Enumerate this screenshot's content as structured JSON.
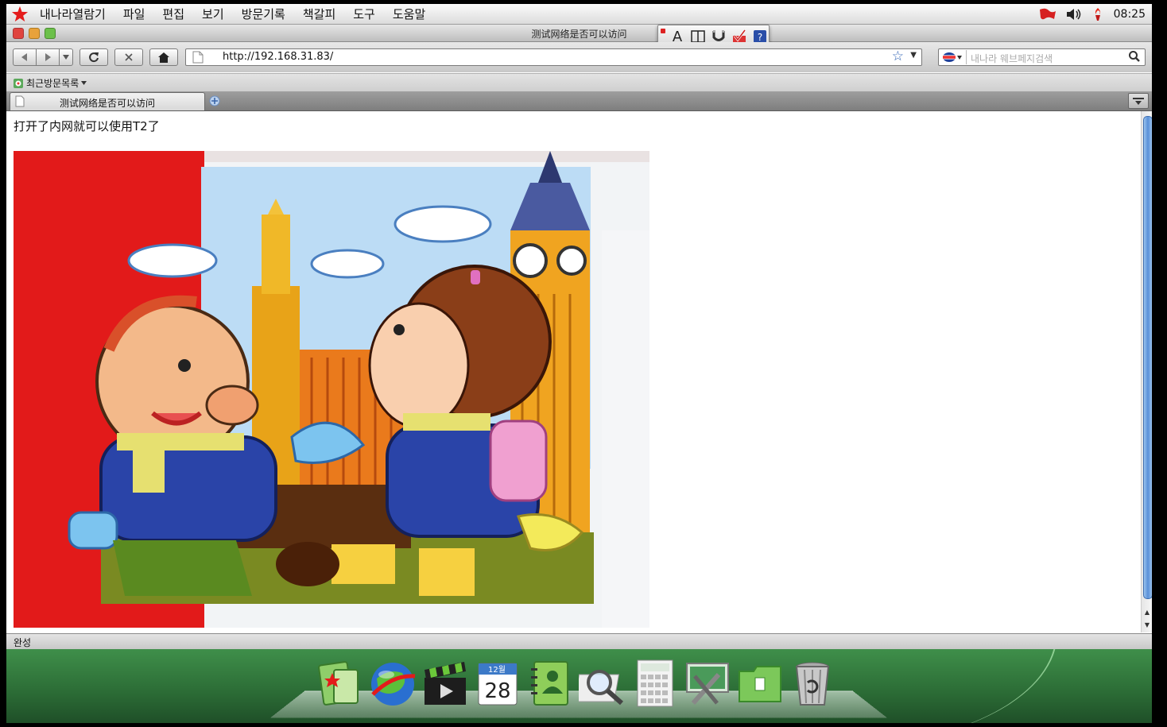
{
  "menubar": {
    "items": [
      "내나라열람기",
      "파일",
      "편집",
      "보기",
      "방문기록",
      "책갈피",
      "도구",
      "도움말"
    ],
    "clock": "08:25"
  },
  "window": {
    "title": "测试网络是否可以访问"
  },
  "navigation": {
    "url": "http://192.168.31.83/",
    "search_placeholder": "내나라 웨브페지검색"
  },
  "bookmarks": {
    "recent_label": "최근방문목록"
  },
  "tabs": [
    {
      "label": "测试网络是否可以访问"
    }
  ],
  "content": {
    "text": "打开了内网就可以使用T2了"
  },
  "status": {
    "text": "완성"
  },
  "calendar": {
    "month": "12월",
    "day": "28"
  },
  "colors": {
    "scroll_accent": "#5a90d8",
    "star_red": "#e41b1b"
  }
}
